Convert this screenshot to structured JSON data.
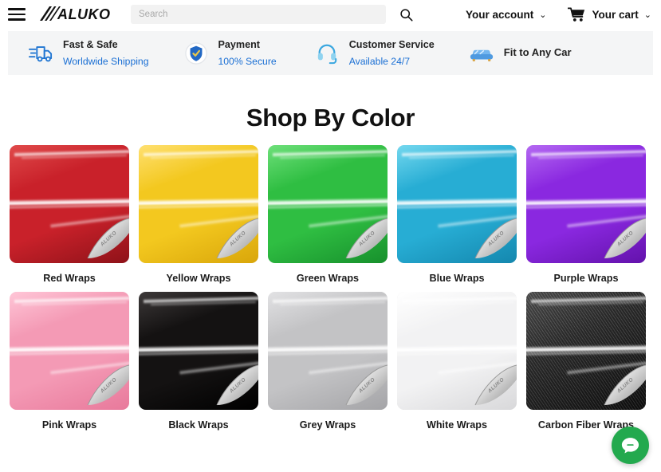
{
  "header": {
    "menu_icon": "hamburger-menu-icon",
    "logo_text": "ALUKO",
    "search": {
      "placeholder": "Search",
      "value": "",
      "icon": "search-icon"
    },
    "account_label": "Your account",
    "account_caret": "⌄",
    "cart_label": "Your cart",
    "cart_caret": "⌄",
    "cart_icon": "shopping-cart-icon"
  },
  "benefits": {
    "background": "#f4f5f6",
    "accent": "#1a6fd4",
    "items": [
      {
        "icon": "delivery-truck-icon",
        "title": "Fast & Safe",
        "subtitle": "Worldwide Shipping"
      },
      {
        "icon": "shield-check-icon",
        "title": "Payment",
        "subtitle": "100% Secure"
      },
      {
        "icon": "headset-icon",
        "title": "Customer Service",
        "subtitle": "Available 24/7"
      },
      {
        "icon": "car-icon",
        "title": "Fit to Any Car",
        "subtitle": ""
      }
    ]
  },
  "main": {
    "title": "Shop By Color",
    "peel_brand": "ALUKO",
    "cards": [
      {
        "label": "Red Wraps",
        "color": "#c9212a",
        "color_dark": "#8e1219",
        "color_light": "#e04a4a",
        "texture": "gloss"
      },
      {
        "label": "Yellow Wraps",
        "color": "#f3c81f",
        "color_dark": "#d9a60a",
        "color_light": "#ffe070",
        "texture": "gloss"
      },
      {
        "label": "Green Wraps",
        "color": "#2fbe42",
        "color_dark": "#17902c",
        "color_light": "#6ee07a",
        "texture": "gloss"
      },
      {
        "label": "Blue Wraps",
        "color": "#27add4",
        "color_dark": "#1487ae",
        "color_light": "#74d8ef",
        "texture": "gloss"
      },
      {
        "label": "Purple Wraps",
        "color": "#8a28e0",
        "color_dark": "#6312ab",
        "color_light": "#b469f2",
        "texture": "gloss"
      },
      {
        "label": "Pink Wraps",
        "color": "#f49ab5",
        "color_dark": "#e8799b",
        "color_light": "#ffc6d7",
        "texture": "gloss"
      },
      {
        "label": "Black Wraps",
        "color": "#141212",
        "color_dark": "#000000",
        "color_light": "#3d3939",
        "texture": "gloss"
      },
      {
        "label": "Grey Wraps",
        "color": "#c3c3c5",
        "color_dark": "#a4a4a7",
        "color_light": "#e2e2e4",
        "texture": "gloss"
      },
      {
        "label": "White Wraps",
        "color": "#f2f2f3",
        "color_dark": "#d8d8da",
        "color_light": "#ffffff",
        "texture": "gloss"
      },
      {
        "label": "Carbon Fiber Wraps",
        "color": "#333333",
        "color_dark": "#101010",
        "color_light": "#5a5a5a",
        "texture": "carbon"
      }
    ]
  },
  "chat": {
    "icon": "chat-bubble-icon",
    "color": "#23a94e"
  }
}
